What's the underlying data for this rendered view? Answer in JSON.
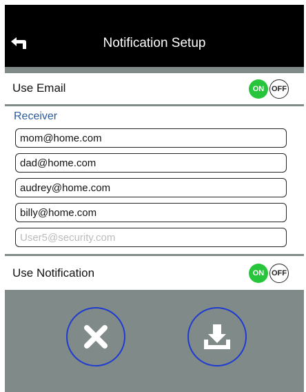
{
  "header": {
    "title": "Notification Setup"
  },
  "use_email": {
    "label": "Use Email",
    "on_label": "ON",
    "off_label": "OFF",
    "state": "on"
  },
  "receiver": {
    "label": "Receiver",
    "fields": [
      {
        "value": "mom@home.com",
        "placeholder": ""
      },
      {
        "value": "dad@home.com",
        "placeholder": ""
      },
      {
        "value": "audrey@home.com",
        "placeholder": ""
      },
      {
        "value": "billy@home.com",
        "placeholder": ""
      },
      {
        "value": "",
        "placeholder": "User5@security.com"
      }
    ]
  },
  "use_notification": {
    "label": "Use Notification",
    "on_label": "ON",
    "off_label": "OFF",
    "state": "on"
  },
  "actions": {
    "cancel_icon": "close-icon",
    "save_icon": "download-icon"
  },
  "colors": {
    "header": "#000000",
    "on": "#27c53b",
    "panel": "#808a89",
    "accent": "#2a5aa0",
    "button_ring": "#1d3bd1"
  }
}
